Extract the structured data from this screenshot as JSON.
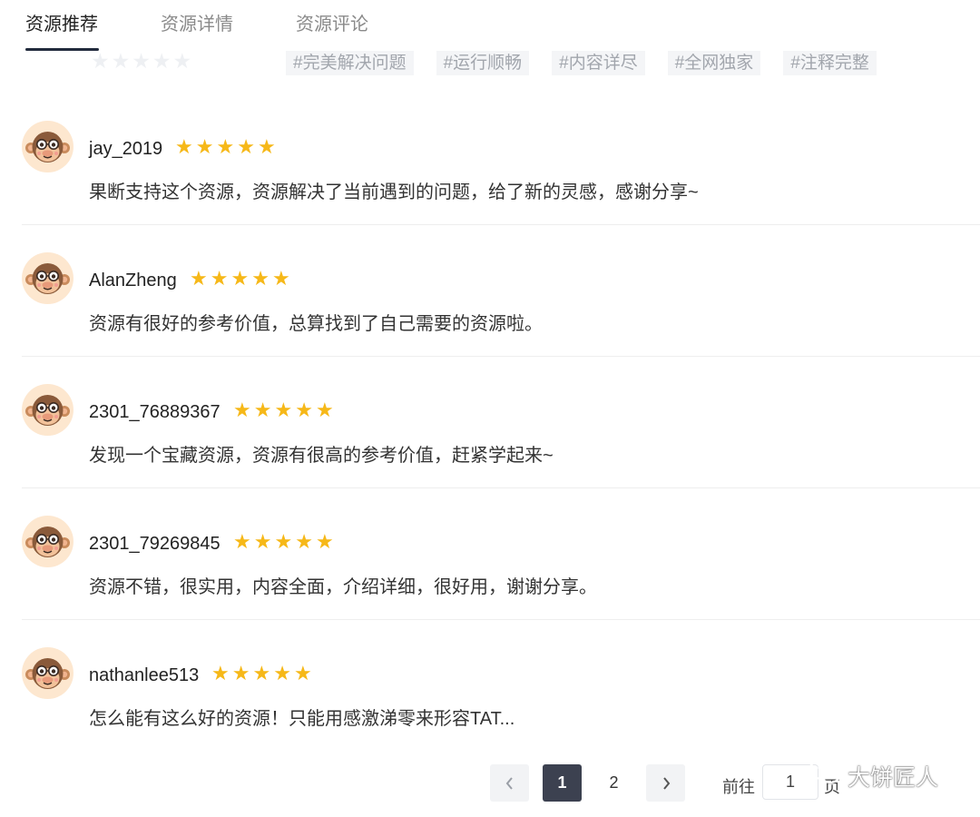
{
  "tabs": [
    {
      "label": "资源推荐",
      "active": true
    },
    {
      "label": "资源详情",
      "active": false
    },
    {
      "label": "资源评论",
      "active": false
    }
  ],
  "filter": {
    "rating": 0,
    "tags": [
      "#完美解决问题",
      "#运行顺畅",
      "#内容详尽",
      "#全网独家",
      "#注释完整"
    ]
  },
  "comments": [
    {
      "user": "jay_2019",
      "rating": 5,
      "text": "果断支持这个资源，资源解决了当前遇到的问题，给了新的灵感，感谢分享~"
    },
    {
      "user": "AlanZheng",
      "rating": 5,
      "text": "资源有很好的参考价值，总算找到了自己需要的资源啦。"
    },
    {
      "user": "2301_76889367",
      "rating": 5,
      "text": "发现一个宝藏资源，资源有很高的参考价值，赶紧学起来~"
    },
    {
      "user": "2301_79269845",
      "rating": 5,
      "text": "资源不错，很实用，内容全面，介绍详细，很好用，谢谢分享。"
    },
    {
      "user": "nathanlee513",
      "rating": 5,
      "text": "怎么能有这么好的资源！只能用感激涕零来形容TAT..."
    }
  ],
  "pagination": {
    "prev_icon": "chevron-left-icon",
    "next_icon": "chevron-right-icon",
    "pages": [
      "1",
      "2"
    ],
    "current": "1",
    "goto_label": "前往",
    "goto_value": "1",
    "goto_suffix": "页"
  },
  "watermark": {
    "text": "大饼匠人",
    "icon": "wechat-icon"
  },
  "colors": {
    "star_filled": "#f6b818",
    "star_empty": "#eef0f3",
    "active_page_bg": "#3c4150",
    "tag_bg": "#f4f5f7",
    "avatar_bg": "#fde7cf"
  }
}
